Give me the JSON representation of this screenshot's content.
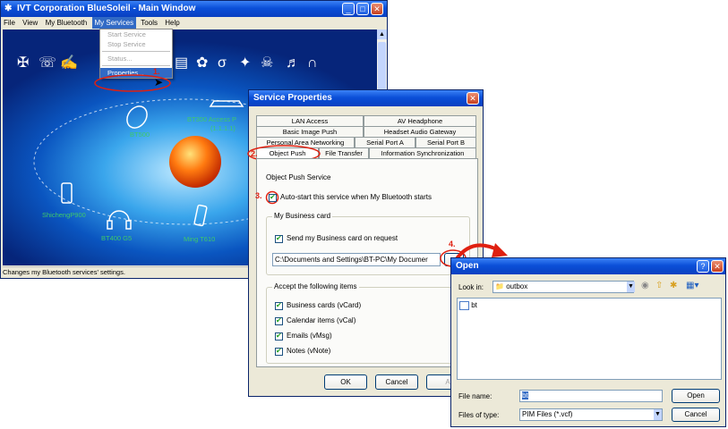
{
  "main_window": {
    "title": "IVT Corporation BlueSoleil - Main Window",
    "menu": [
      "File",
      "View",
      "My Bluetooth",
      "My Services",
      "Tools",
      "Help"
    ],
    "service_menu": [
      "Start Service",
      "Stop Service",
      "Status...",
      "Properties..."
    ],
    "devices": [
      "BT300 Access P",
      "(1.1.1.1)",
      "BT500",
      "ShichengP900",
      "BT400 G5",
      "Ming T610"
    ],
    "status": "Changes my Bluetooth services' settings."
  },
  "steps": [
    "1.",
    "2.",
    "3.",
    "4."
  ],
  "service_props": {
    "title": "Service Properties",
    "tabs_row1": [
      "LAN Access",
      "AV Headphone"
    ],
    "tabs_row2": [
      "Basic Image Push",
      "Headset Audio Gateway"
    ],
    "tabs_row3": [
      "Personal Area Networking",
      "Serial Port A",
      "Serial Port B"
    ],
    "tabs_row4": [
      "Object Push",
      "File Transfer",
      "Information Synchronization"
    ],
    "service_name": "Object Push Service",
    "autostart": "Auto-start this service when My Bluetooth starts",
    "card_group": "My Business card",
    "send_card": "Send my Business card on request",
    "card_path": "C:\\Documents and Settings\\BT-PC\\My Documer",
    "browse": "...",
    "accept_group": "Accept the following items",
    "accept_items": [
      "Business cards (vCard)",
      "Calendar items (vCal)",
      "Emails (vMsg)",
      "Notes (vNote)"
    ],
    "ok": "OK",
    "cancel": "Cancel",
    "apply": "A"
  },
  "open_dialog": {
    "title": "Open",
    "look_in_label": "Look in:",
    "look_in_value": "outbox",
    "file_item": "bt",
    "file_name_label": "File name:",
    "file_name_value": "bt",
    "files_type_label": "Files of type:",
    "files_type_value": "PIM Files (*.vcf)",
    "open": "Open",
    "cancel": "Cancel"
  },
  "colors": {
    "title_blue": "#0b4fd8",
    "step_red": "#e02010",
    "menu_highlight": "#316ac5",
    "device_green": "#3fc86a"
  }
}
